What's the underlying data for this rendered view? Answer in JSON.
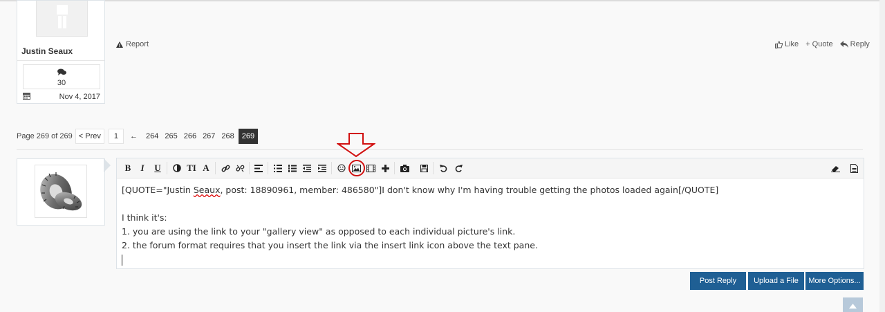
{
  "post": {
    "username": "Justin Seaux",
    "message_count": "30",
    "joined": "Nov 4, 2017",
    "report_label": "Report",
    "like_label": "Like",
    "quote_label": "+ Quote",
    "reply_label": "Reply"
  },
  "pager": {
    "label": "Page 269 of 269",
    "prev": "< Prev",
    "first": "1",
    "gap": "←",
    "pages": [
      "264",
      "265",
      "266",
      "267",
      "268"
    ],
    "current": "269"
  },
  "editor": {
    "toolbar": {
      "bold": "B",
      "italic": "I",
      "underline": "U",
      "font_size": "TI",
      "font": "A"
    },
    "lines": {
      "quote_pre": "[QUOTE=\"Justin ",
      "quote_name": "Seaux",
      "quote_post": ", post: 18890961, member: 486580\"]I don't know why I'm having trouble getting the photos loaded again[/QUOTE]",
      "l2": "I think it's:",
      "l3": "1. you are using the link to your \"gallery view\" as opposed to each individual picture's link.",
      "l4": "2. the forum format requires that you insert the link via the insert link icon above the text pane."
    }
  },
  "buttons": {
    "post_reply": "Post Reply",
    "upload": "Upload a File",
    "more": "More Options..."
  },
  "colors": {
    "button": "#1f5f94",
    "annotation": "#d10f0f"
  }
}
